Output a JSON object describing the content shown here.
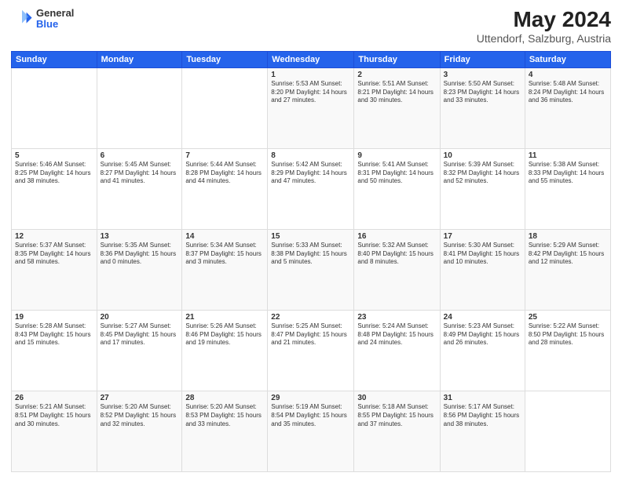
{
  "header": {
    "logo": {
      "general": "General",
      "blue": "Blue"
    },
    "title": "May 2024",
    "subtitle": "Uttendorf, Salzburg, Austria"
  },
  "weekdays": [
    "Sunday",
    "Monday",
    "Tuesday",
    "Wednesday",
    "Thursday",
    "Friday",
    "Saturday"
  ],
  "weeks": [
    [
      {
        "day": "",
        "info": ""
      },
      {
        "day": "",
        "info": ""
      },
      {
        "day": "",
        "info": ""
      },
      {
        "day": "1",
        "info": "Sunrise: 5:53 AM\nSunset: 8:20 PM\nDaylight: 14 hours and 27 minutes."
      },
      {
        "day": "2",
        "info": "Sunrise: 5:51 AM\nSunset: 8:21 PM\nDaylight: 14 hours and 30 minutes."
      },
      {
        "day": "3",
        "info": "Sunrise: 5:50 AM\nSunset: 8:23 PM\nDaylight: 14 hours and 33 minutes."
      },
      {
        "day": "4",
        "info": "Sunrise: 5:48 AM\nSunset: 8:24 PM\nDaylight: 14 hours and 36 minutes."
      }
    ],
    [
      {
        "day": "5",
        "info": "Sunrise: 5:46 AM\nSunset: 8:25 PM\nDaylight: 14 hours and 38 minutes."
      },
      {
        "day": "6",
        "info": "Sunrise: 5:45 AM\nSunset: 8:27 PM\nDaylight: 14 hours and 41 minutes."
      },
      {
        "day": "7",
        "info": "Sunrise: 5:44 AM\nSunset: 8:28 PM\nDaylight: 14 hours and 44 minutes."
      },
      {
        "day": "8",
        "info": "Sunrise: 5:42 AM\nSunset: 8:29 PM\nDaylight: 14 hours and 47 minutes."
      },
      {
        "day": "9",
        "info": "Sunrise: 5:41 AM\nSunset: 8:31 PM\nDaylight: 14 hours and 50 minutes."
      },
      {
        "day": "10",
        "info": "Sunrise: 5:39 AM\nSunset: 8:32 PM\nDaylight: 14 hours and 52 minutes."
      },
      {
        "day": "11",
        "info": "Sunrise: 5:38 AM\nSunset: 8:33 PM\nDaylight: 14 hours and 55 minutes."
      }
    ],
    [
      {
        "day": "12",
        "info": "Sunrise: 5:37 AM\nSunset: 8:35 PM\nDaylight: 14 hours and 58 minutes."
      },
      {
        "day": "13",
        "info": "Sunrise: 5:35 AM\nSunset: 8:36 PM\nDaylight: 15 hours and 0 minutes."
      },
      {
        "day": "14",
        "info": "Sunrise: 5:34 AM\nSunset: 8:37 PM\nDaylight: 15 hours and 3 minutes."
      },
      {
        "day": "15",
        "info": "Sunrise: 5:33 AM\nSunset: 8:38 PM\nDaylight: 15 hours and 5 minutes."
      },
      {
        "day": "16",
        "info": "Sunrise: 5:32 AM\nSunset: 8:40 PM\nDaylight: 15 hours and 8 minutes."
      },
      {
        "day": "17",
        "info": "Sunrise: 5:30 AM\nSunset: 8:41 PM\nDaylight: 15 hours and 10 minutes."
      },
      {
        "day": "18",
        "info": "Sunrise: 5:29 AM\nSunset: 8:42 PM\nDaylight: 15 hours and 12 minutes."
      }
    ],
    [
      {
        "day": "19",
        "info": "Sunrise: 5:28 AM\nSunset: 8:43 PM\nDaylight: 15 hours and 15 minutes."
      },
      {
        "day": "20",
        "info": "Sunrise: 5:27 AM\nSunset: 8:45 PM\nDaylight: 15 hours and 17 minutes."
      },
      {
        "day": "21",
        "info": "Sunrise: 5:26 AM\nSunset: 8:46 PM\nDaylight: 15 hours and 19 minutes."
      },
      {
        "day": "22",
        "info": "Sunrise: 5:25 AM\nSunset: 8:47 PM\nDaylight: 15 hours and 21 minutes."
      },
      {
        "day": "23",
        "info": "Sunrise: 5:24 AM\nSunset: 8:48 PM\nDaylight: 15 hours and 24 minutes."
      },
      {
        "day": "24",
        "info": "Sunrise: 5:23 AM\nSunset: 8:49 PM\nDaylight: 15 hours and 26 minutes."
      },
      {
        "day": "25",
        "info": "Sunrise: 5:22 AM\nSunset: 8:50 PM\nDaylight: 15 hours and 28 minutes."
      }
    ],
    [
      {
        "day": "26",
        "info": "Sunrise: 5:21 AM\nSunset: 8:51 PM\nDaylight: 15 hours and 30 minutes."
      },
      {
        "day": "27",
        "info": "Sunrise: 5:20 AM\nSunset: 8:52 PM\nDaylight: 15 hours and 32 minutes."
      },
      {
        "day": "28",
        "info": "Sunrise: 5:20 AM\nSunset: 8:53 PM\nDaylight: 15 hours and 33 minutes."
      },
      {
        "day": "29",
        "info": "Sunrise: 5:19 AM\nSunset: 8:54 PM\nDaylight: 15 hours and 35 minutes."
      },
      {
        "day": "30",
        "info": "Sunrise: 5:18 AM\nSunset: 8:55 PM\nDaylight: 15 hours and 37 minutes."
      },
      {
        "day": "31",
        "info": "Sunrise: 5:17 AM\nSunset: 8:56 PM\nDaylight: 15 hours and 38 minutes."
      },
      {
        "day": "",
        "info": ""
      }
    ]
  ]
}
